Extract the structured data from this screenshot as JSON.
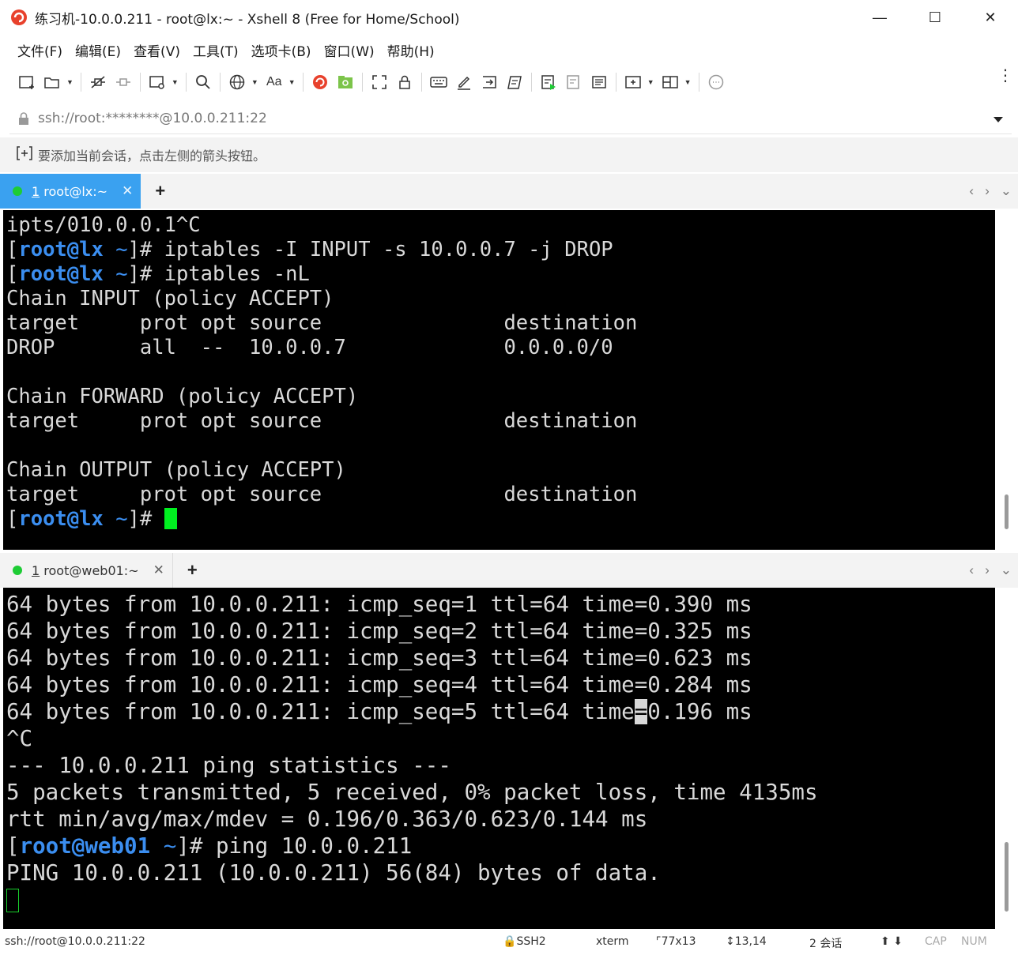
{
  "window": {
    "title": "练习机-10.0.0.211 - root@lx:~ - Xshell 8 (Free for Home/School)",
    "minimize": "—",
    "maximize": "☐",
    "close": "✕"
  },
  "menu": {
    "file": "文件(F)",
    "edit": "编辑(E)",
    "view": "查看(V)",
    "tools": "工具(T)",
    "tabs": "选项卡(B)",
    "window": "窗口(W)",
    "help": "帮助(H)"
  },
  "toolbar": {
    "font_label": "Aa"
  },
  "address": {
    "value": "ssh://root:********@10.0.0.211:22"
  },
  "hint": {
    "text": "要添加当前会话，点击左侧的箭头按钮。"
  },
  "tab_top": {
    "number": "1",
    "label": " root@lx:~",
    "close": "✕",
    "add": "+"
  },
  "tab_bottom": {
    "number": "1",
    "label": " root@web01:~",
    "close": "✕",
    "add": "+"
  },
  "term_top": {
    "line1": "ipts/010.0.0.1^C",
    "prompt_open": "[",
    "prompt_user": "root@lx",
    "prompt_tilde": "~",
    "prompt_close": "]# ",
    "cmd1": "iptables -I INPUT -s 10.0.0.7 -j DROP",
    "cmd2": "iptables -nL",
    "chain_input": "Chain INPUT (policy ACCEPT)",
    "header1": "target     prot opt source               destination",
    "drop_row": "DROP       all  --  10.0.0.7             0.0.0.0/0",
    "chain_forward": "Chain FORWARD (policy ACCEPT)",
    "header2": "target     prot opt source               destination",
    "chain_output": "Chain OUTPUT (policy ACCEPT)",
    "header3": "target     prot opt source               destination"
  },
  "term_bottom": {
    "ping1": "64 bytes from 10.0.0.211: icmp_seq=1 ttl=64 time=0.390 ms",
    "ping2": "64 bytes from 10.0.0.211: icmp_seq=2 ttl=64 time=0.325 ms",
    "ping3": "64 bytes from 10.0.0.211: icmp_seq=3 ttl=64 time=0.623 ms",
    "ping4": "64 bytes from 10.0.0.211: icmp_seq=4 ttl=64 time=0.284 ms",
    "ping5_a": "64 bytes from 10.0.0.211: icmp_seq=5 ttl=64 time",
    "ping5_sel": "=",
    "ping5_b": "0.196 ms",
    "ctrl_c": "^C",
    "stats_header": "--- 10.0.0.211 ping statistics ---",
    "stats_packets": "5 packets transmitted, 5 received, 0% packet loss, time 4135ms",
    "stats_rtt": "rtt min/avg/max/mdev = 0.196/0.363/0.623/0.144 ms",
    "prompt_open": "[",
    "prompt_user": "root@web01",
    "prompt_tilde": "~",
    "prompt_close": "]# ",
    "cmd": "ping 10.0.0.211",
    "ping_header": "PING 10.0.0.211 (10.0.0.211) 56(84) bytes of data."
  },
  "status": {
    "address": "ssh://root@10.0.0.211:22",
    "protocol": "SSH2",
    "term_type": "xterm",
    "size": "77x13",
    "position": "13,14",
    "sessions": "2 会话",
    "caps": "CAP",
    "num": "NUM"
  },
  "colors": {
    "active_tab": "#3aa1f0",
    "prompt_blue": "#3b8ef0",
    "cursor_green": "#00f020",
    "status_dot": "#1ecc35"
  }
}
